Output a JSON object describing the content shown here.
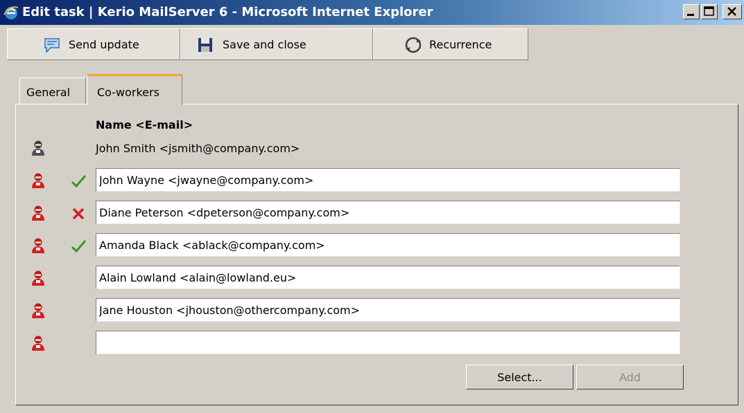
{
  "window": {
    "title": "Edit task | Kerio MailServer 6 - Microsoft Internet Explorer"
  },
  "toolbar": {
    "send_update": "Send update",
    "save_and_close": "Save and close",
    "recurrence": "Recurrence"
  },
  "tabs": [
    {
      "label": "General",
      "active": false
    },
    {
      "label": "Co-workers",
      "active": true
    }
  ],
  "coworkers": {
    "column_header": "Name <E-mail>",
    "owner": "John Smith <jsmith@company.com>",
    "entries": [
      {
        "value": "John Wayne <jwayne@company.com>",
        "status": "accepted"
      },
      {
        "value": "Diane Peterson <dpeterson@company.com>",
        "status": "declined"
      },
      {
        "value": "Amanda Black <ablack@company.com>",
        "status": "accepted"
      },
      {
        "value": "Alain Lowland <alain@lowland.eu>",
        "status": "none"
      },
      {
        "value": "Jane Houston <jhouston@othercompany.com>",
        "status": "none"
      },
      {
        "value": "",
        "status": "none"
      }
    ]
  },
  "buttons": {
    "select": "Select...",
    "add": "Add"
  },
  "colors": {
    "accepted": "#2e9a2e",
    "declined": "#d42020",
    "tab_accent": "#f0a830"
  }
}
